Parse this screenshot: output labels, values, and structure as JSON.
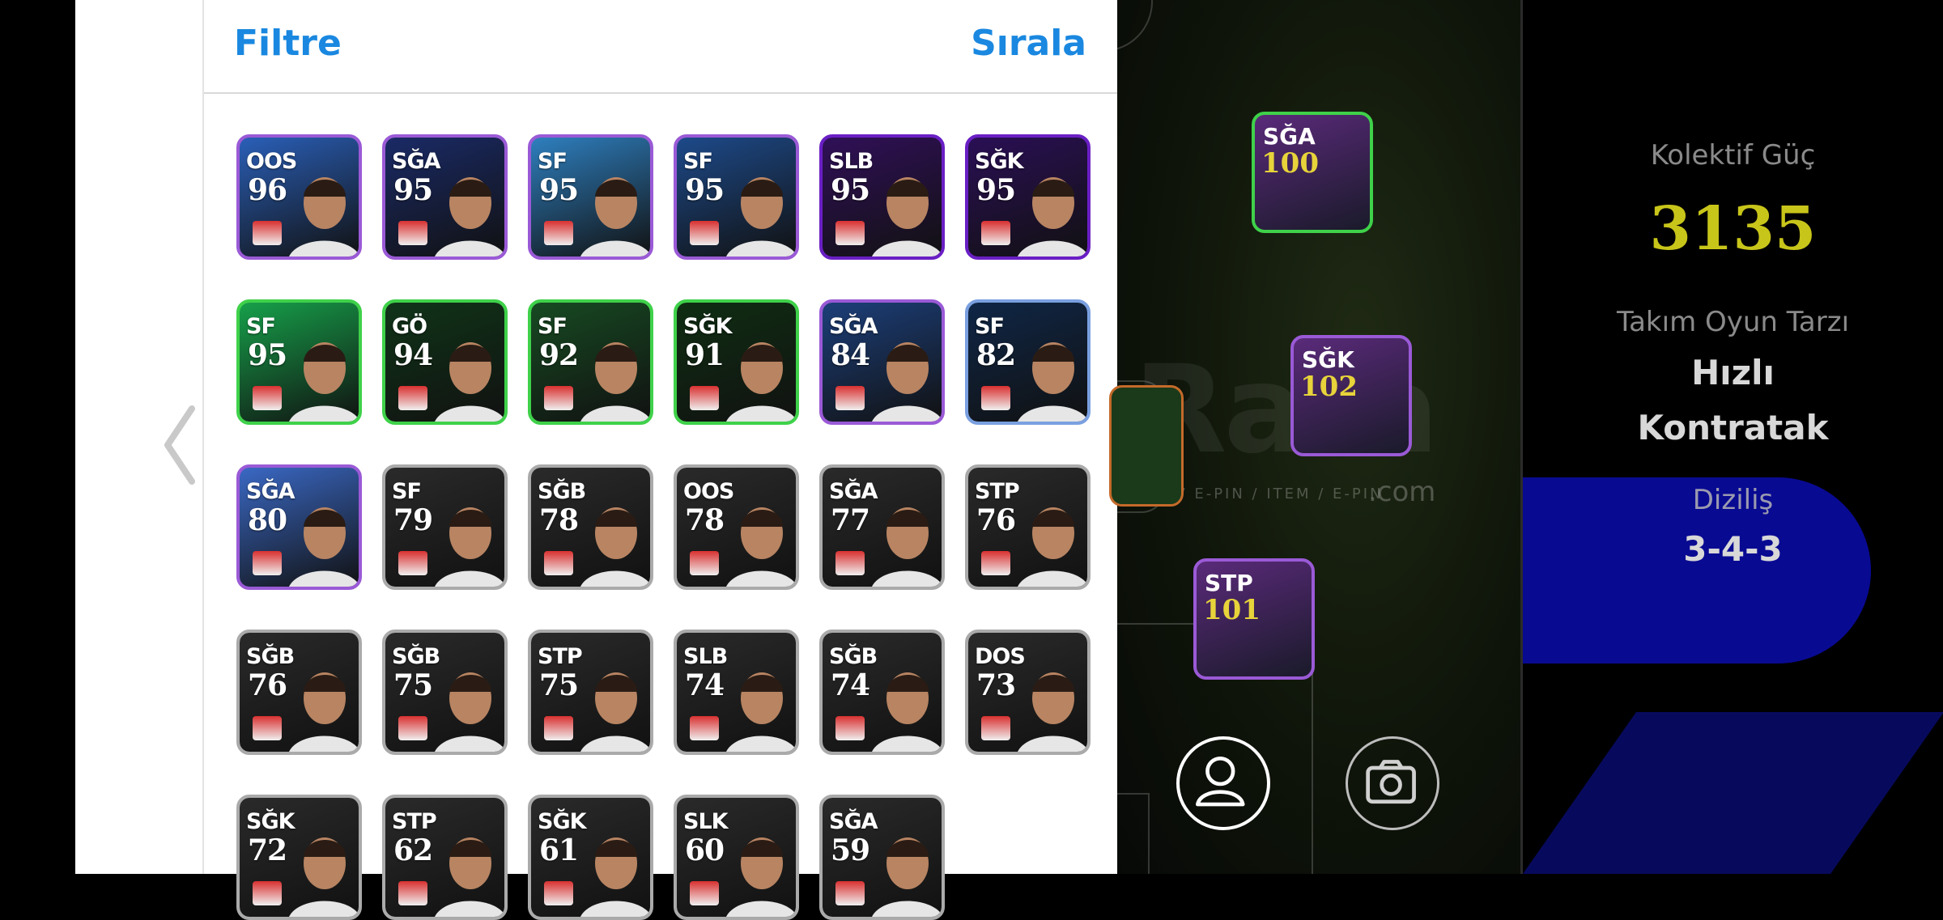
{
  "header": {
    "filter_label": "Filtre",
    "sort_label": "Sırala"
  },
  "players": [
    {
      "pos": "OOS",
      "rating": "96",
      "frame": "#9a5ad6",
      "bg": "#2a5fb8"
    },
    {
      "pos": "SĞA",
      "rating": "95",
      "frame": "#9a5ad6",
      "bg": "#1a2a66"
    },
    {
      "pos": "SF",
      "rating": "95",
      "frame": "#9a5ad6",
      "bg": "#2e7fbf"
    },
    {
      "pos": "SF",
      "rating": "95",
      "frame": "#9a5ad6",
      "bg": "#1d4a8a"
    },
    {
      "pos": "SLB",
      "rating": "95",
      "frame": "#6a1fc4",
      "bg": "#301058"
    },
    {
      "pos": "SĞK",
      "rating": "95",
      "frame": "#6a1fc4",
      "bg": "#2a0f55"
    },
    {
      "pos": "SF",
      "rating": "95",
      "frame": "#3fd14a",
      "bg": "#16a04a"
    },
    {
      "pos": "GÖ",
      "rating": "94",
      "frame": "#3fd14a",
      "bg": "#103418"
    },
    {
      "pos": "SF",
      "rating": "92",
      "frame": "#3fd14a",
      "bg": "#174a22"
    },
    {
      "pos": "SĞK",
      "rating": "91",
      "frame": "#3fd14a",
      "bg": "#0f2e12"
    },
    {
      "pos": "SĞA",
      "rating": "84",
      "frame": "#9a5ad6",
      "bg": "#1c3f7a"
    },
    {
      "pos": "SF",
      "rating": "82",
      "frame": "#7aa0e0",
      "bg": "#0f2646"
    },
    {
      "pos": "SĞA",
      "rating": "80",
      "frame": "#9a5ad6",
      "bg": "#3a68c4"
    },
    {
      "pos": "SF",
      "rating": "79",
      "frame": "#aaaaaa",
      "bg": "#2a2a2a"
    },
    {
      "pos": "SĞB",
      "rating": "78",
      "frame": "#aaaaaa",
      "bg": "#2a2a2a"
    },
    {
      "pos": "OOS",
      "rating": "78",
      "frame": "#aaaaaa",
      "bg": "#2a2a2a"
    },
    {
      "pos": "SĞA",
      "rating": "77",
      "frame": "#aaaaaa",
      "bg": "#2a2a2a"
    },
    {
      "pos": "STP",
      "rating": "76",
      "frame": "#aaaaaa",
      "bg": "#2a2a2a"
    },
    {
      "pos": "SĞB",
      "rating": "76",
      "frame": "#aaaaaa",
      "bg": "#2a2a2a"
    },
    {
      "pos": "SĞB",
      "rating": "75",
      "frame": "#aaaaaa",
      "bg": "#2a2a2a"
    },
    {
      "pos": "STP",
      "rating": "75",
      "frame": "#aaaaaa",
      "bg": "#2a2a2a"
    },
    {
      "pos": "SLB",
      "rating": "74",
      "frame": "#aaaaaa",
      "bg": "#2a2a2a"
    },
    {
      "pos": "SĞB",
      "rating": "74",
      "frame": "#aaaaaa",
      "bg": "#2a2a2a"
    },
    {
      "pos": "DOS",
      "rating": "73",
      "frame": "#aaaaaa",
      "bg": "#2a2a2a"
    },
    {
      "pos": "SĞK",
      "rating": "72",
      "frame": "#aaaaaa",
      "bg": "#2a2a2a"
    },
    {
      "pos": "STP",
      "rating": "62",
      "frame": "#aaaaaa",
      "bg": "#2a2a2a"
    },
    {
      "pos": "SĞK",
      "rating": "61",
      "frame": "#aaaaaa",
      "bg": "#2a2a2a"
    },
    {
      "pos": "SLK",
      "rating": "60",
      "frame": "#aaaaaa",
      "bg": "#2a2a2a"
    },
    {
      "pos": "SĞA",
      "rating": "59",
      "frame": "#aaaaaa",
      "bg": "#2a2a2a"
    }
  ],
  "field_cards": [
    {
      "pos": "SĞA",
      "rating": "100",
      "frame": "#3fd14a"
    },
    {
      "pos": "SĞK",
      "rating": "102",
      "frame": "#9a5ad6"
    },
    {
      "pos": "STP",
      "rating": "101",
      "frame": "#9a5ad6"
    }
  ],
  "team": {
    "strength_label": "Kolektif Güç",
    "strength_value": "3135",
    "style_label": "Takım Oyun Tarzı",
    "style_value_1": "Hızlı",
    "style_value_2": "Kontratak",
    "formation_label": "Diziliş",
    "formation_value": "3-4-3"
  },
  "watermark": {
    "text": "Rata",
    "tagline": "OYUN / E-PIN / ITEM / E-PIN",
    "domain": ".com"
  },
  "colors": {
    "accent": "#1a88e0",
    "strength": "#c8c51a"
  }
}
